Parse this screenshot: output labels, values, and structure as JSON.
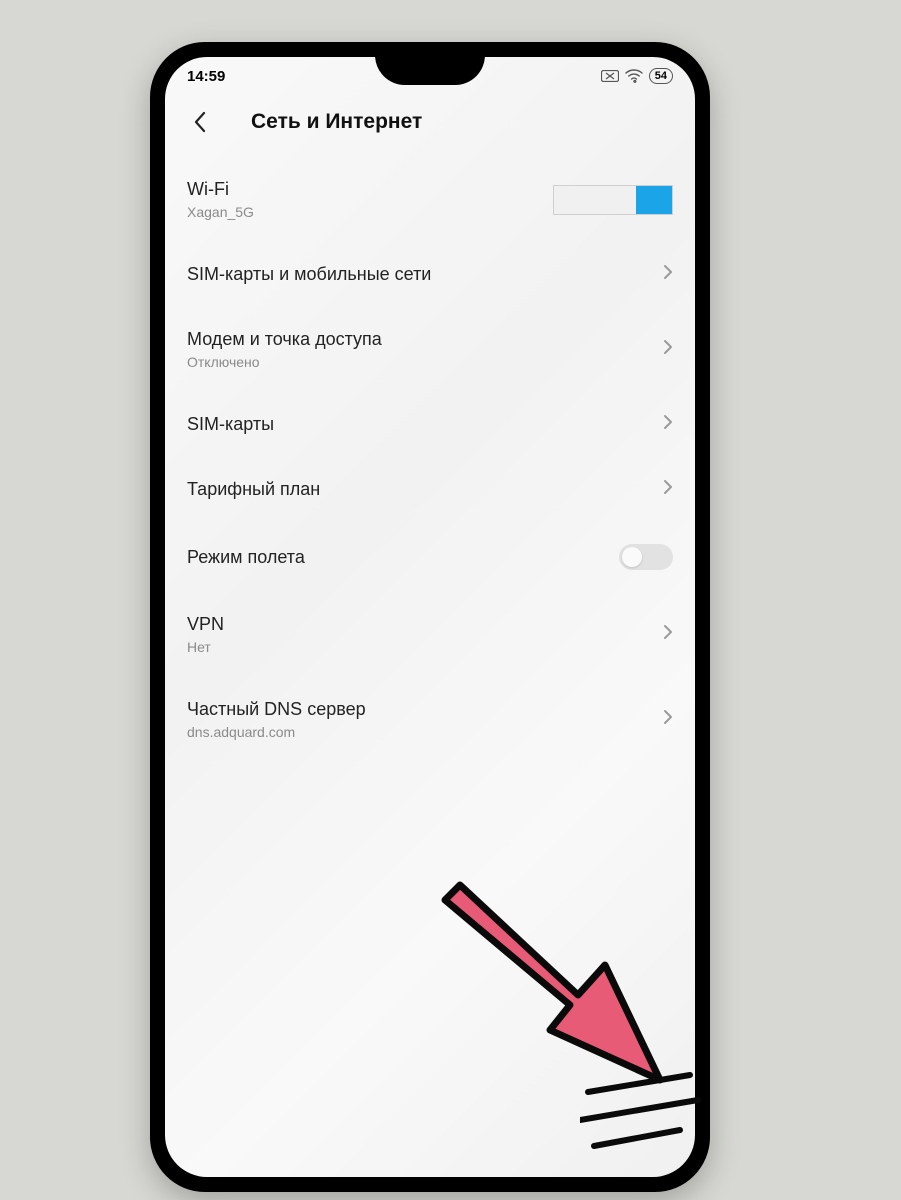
{
  "statusbar": {
    "time": "14:59",
    "battery": "54"
  },
  "header": {
    "title": "Сеть и Интернет"
  },
  "rows": {
    "wifi": {
      "label": "Wi-Fi",
      "sub": "Xagan_5G"
    },
    "sim_net": {
      "label": "SIM-карты и мобильные сети"
    },
    "hotspot": {
      "label": "Модем и точка доступа",
      "sub": "Отключено"
    },
    "sim": {
      "label": "SIM-карты"
    },
    "plan": {
      "label": "Тарифный план"
    },
    "airplane": {
      "label": "Режим полета"
    },
    "vpn": {
      "label": "VPN",
      "sub": "Нет"
    },
    "dns": {
      "label": "Частный DNS сервер",
      "sub": "dns.adquard.com"
    }
  },
  "annotation": {
    "arrow_color": "#e85b77"
  }
}
